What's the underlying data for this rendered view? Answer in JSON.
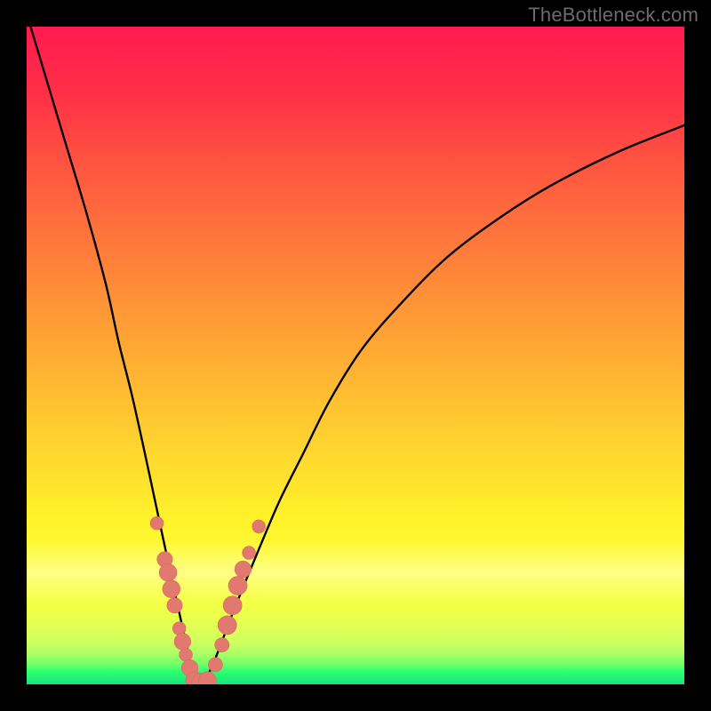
{
  "watermark": "TheBottleneck.com",
  "colors": {
    "background": "#000000",
    "curve": "#000000",
    "marker_fill": "#e2796e",
    "marker_stroke": "#d96a60"
  },
  "chart_data": {
    "type": "line",
    "title": "",
    "xlabel": "",
    "ylabel": "",
    "xlim": [
      0,
      100
    ],
    "ylim": [
      0,
      100
    ],
    "grid": false,
    "series": [
      {
        "name": "bottleneck-curve",
        "x": [
          0,
          3,
          6,
          9,
          12,
          14,
          16,
          18,
          19.5,
          21,
          22.3,
          23.4,
          24.3,
          25,
          25.7,
          26.5,
          27.3,
          28.3,
          29.5,
          31,
          33,
          35.5,
          38.5,
          42,
          46,
          51,
          57,
          64,
          72,
          80,
          90,
          100
        ],
        "y": [
          102,
          92,
          82,
          72,
          61,
          52,
          44,
          35,
          28,
          21,
          15,
          10,
          6,
          3,
          1,
          0,
          1,
          3,
          6,
          10,
          15,
          21,
          28,
          35,
          43,
          51,
          58,
          65,
          71,
          76,
          81,
          85
        ]
      }
    ],
    "markers": [
      {
        "x": 19.8,
        "y": 24.5,
        "r": 1.2
      },
      {
        "x": 21.0,
        "y": 19.0,
        "r": 1.4
      },
      {
        "x": 21.5,
        "y": 17.0,
        "r": 1.6
      },
      {
        "x": 22.0,
        "y": 14.5,
        "r": 1.6
      },
      {
        "x": 22.5,
        "y": 12.0,
        "r": 1.4
      },
      {
        "x": 23.2,
        "y": 8.5,
        "r": 1.2
      },
      {
        "x": 23.7,
        "y": 6.5,
        "r": 1.5
      },
      {
        "x": 24.2,
        "y": 4.5,
        "r": 1.2
      },
      {
        "x": 24.8,
        "y": 2.5,
        "r": 1.5
      },
      {
        "x": 25.5,
        "y": 0.6,
        "r": 1.6
      },
      {
        "x": 26.5,
        "y": 0.3,
        "r": 1.7
      },
      {
        "x": 27.5,
        "y": 0.6,
        "r": 1.6
      },
      {
        "x": 28.7,
        "y": 3.0,
        "r": 1.3
      },
      {
        "x": 29.7,
        "y": 6.0,
        "r": 1.3
      },
      {
        "x": 30.5,
        "y": 9.0,
        "r": 1.7
      },
      {
        "x": 31.3,
        "y": 12.0,
        "r": 1.7
      },
      {
        "x": 32.1,
        "y": 15.0,
        "r": 1.7
      },
      {
        "x": 32.9,
        "y": 17.5,
        "r": 1.5
      },
      {
        "x": 33.8,
        "y": 20.0,
        "r": 1.2
      },
      {
        "x": 35.3,
        "y": 24.0,
        "r": 1.2
      }
    ]
  }
}
